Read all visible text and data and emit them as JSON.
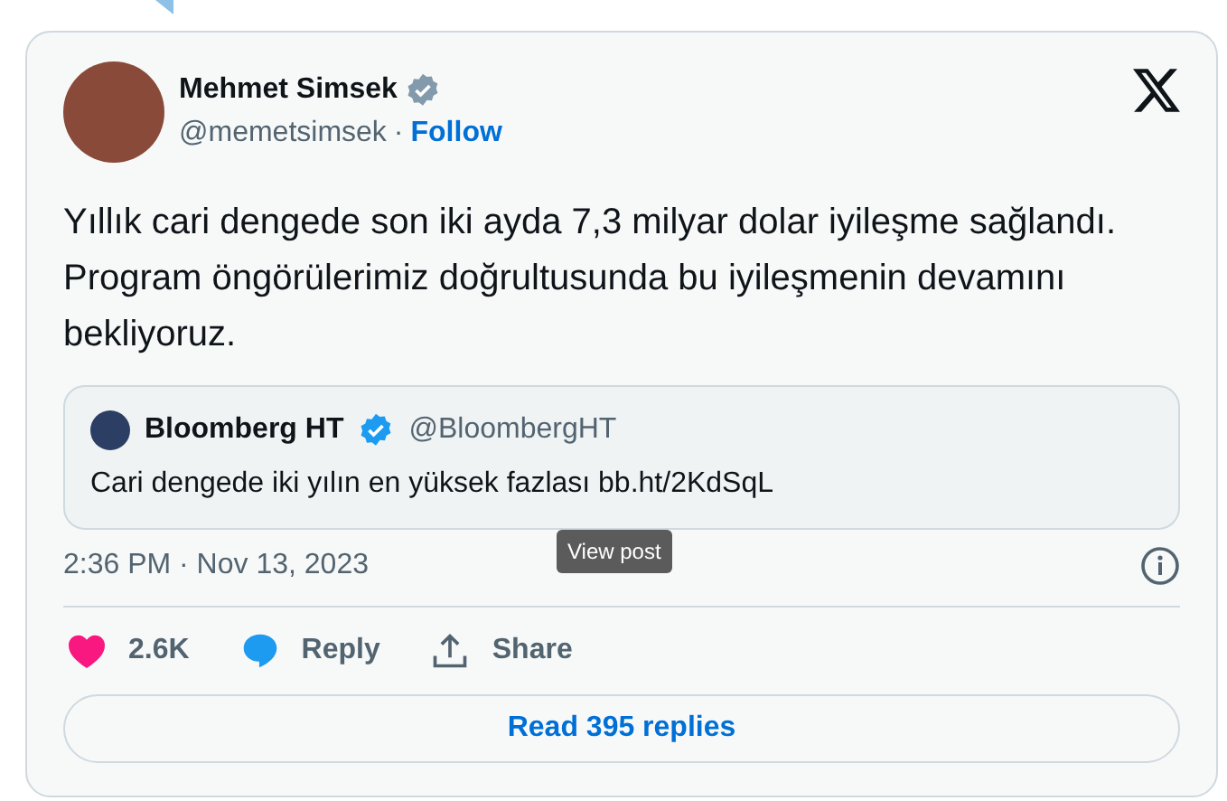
{
  "author": {
    "name": "Mehmet Simsek",
    "handle": "@memetsimsek",
    "separator": "·",
    "follow": "Follow",
    "verified": true
  },
  "text": "Yıllık cari dengede son iki ayda 7,3 milyar dolar iyileşme sağlandı. Program öngörülerimiz doğrultusunda bu iyileşmenin devamını bekliyoruz.",
  "quote": {
    "name": "Bloomberg HT",
    "handle": "@BloombergHT",
    "verified": true,
    "text": "Cari dengede iki yılın en yüksek fazlası bb.ht/2KdSqL"
  },
  "timestamp": "2:36 PM · Nov 13, 2023",
  "tooltip": "View post",
  "actions": [
    {
      "kind": "like",
      "label": "2.6K"
    },
    {
      "kind": "reply",
      "label": "Reply"
    },
    {
      "kind": "share",
      "label": "Share"
    }
  ],
  "read_replies": "Read 395 replies"
}
